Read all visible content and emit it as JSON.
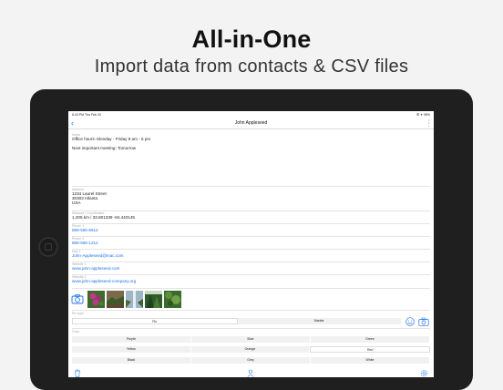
{
  "hero": {
    "title": "All-in-One",
    "subtitle": "Import data from contacts & CSV files"
  },
  "status": {
    "time": "6:43 PM",
    "date": "Thu Feb 20",
    "right": "☰ ✦ 98%"
  },
  "nav": {
    "title": "John Appleseed"
  },
  "notes": {
    "label": "Notes",
    "lines": [
      "Office hours: Monday - Friday 9 am - 5 pm",
      "",
      "Next important meeting: Tomorrow"
    ]
  },
  "address": {
    "label": "Address",
    "lines": [
      "1234 Laurel Street",
      "30303 Atlanta",
      "USA"
    ]
  },
  "distance": {
    "label": "Distance | Coordinates",
    "value": "1,205 km / 33.801339 -84.440145"
  },
  "phone1": {
    "label": "Phone 1",
    "value": "888-555-5512"
  },
  "phone2": {
    "label": "Phone 2",
    "value": "888-555-1212"
  },
  "mail1": {
    "label": "Mail 1",
    "value": "John-Appleseed@mac.com"
  },
  "website1": {
    "label": "Website 1",
    "value": "www.john-appleseed.com"
  },
  "website2": {
    "label": "Website 2",
    "value": "www.john-appleseed-company.org"
  },
  "pin": {
    "label": "Pin type",
    "options": [
      "Pin",
      "Marker"
    ],
    "selected": 0
  },
  "color": {
    "label": "Color",
    "rows": [
      [
        "Purple",
        "Blue",
        "Green"
      ],
      [
        "Yellow",
        "Orange",
        "Red"
      ],
      [
        "Black",
        "Grey",
        "White"
      ]
    ],
    "selected": "Red"
  },
  "colors": {
    "accent": "#1a73e8",
    "separator": "#e4e4e4"
  }
}
